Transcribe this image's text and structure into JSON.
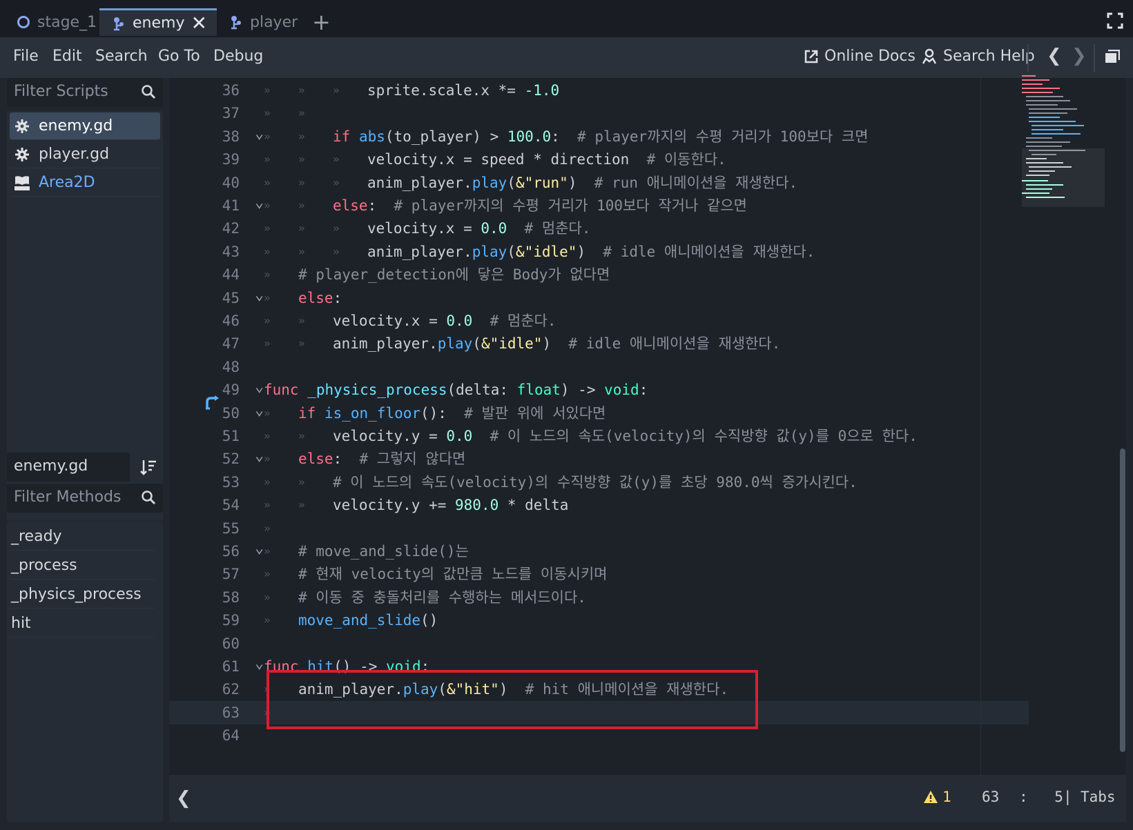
{
  "tabs": [
    {
      "label": "stage_1",
      "icon": "circle-node-icon",
      "active": false
    },
    {
      "label": "enemy",
      "icon": "scene-node-icon",
      "active": true
    },
    {
      "label": "player",
      "icon": "scene-node-icon",
      "active": false
    }
  ],
  "menu": {
    "file": "File",
    "edit": "Edit",
    "search": "Search",
    "goto": "Go To",
    "debug": "Debug"
  },
  "toolbar": {
    "online_docs": "Online Docs",
    "search_help": "Search Help"
  },
  "scripts_panel": {
    "filter_placeholder": "Filter Scripts",
    "items": [
      {
        "label": "enemy.gd",
        "icon": "gear-icon",
        "selected": true
      },
      {
        "label": "player.gd",
        "icon": "gear-icon",
        "selected": false
      },
      {
        "label": "Area2D",
        "icon": "doc-icon",
        "selected": false
      }
    ]
  },
  "methods_panel": {
    "current_script": "enemy.gd",
    "filter_placeholder": "Filter Methods",
    "items": [
      "_ready",
      "_process",
      "_physics_process",
      "hit"
    ]
  },
  "code_lines": [
    {
      "n": "36",
      "fold": false,
      "tabs": 3,
      "tokens": [
        [
          "p",
          "sprite.scale.x *= "
        ],
        [
          "n",
          "-1.0"
        ]
      ]
    },
    {
      "n": "37",
      "fold": false,
      "tabs": 2,
      "tokens": []
    },
    {
      "n": "38",
      "fold": true,
      "tabs": 2,
      "tokens": [
        [
          "k",
          "if "
        ],
        [
          "f",
          "abs"
        ],
        [
          "p",
          "(to_player) > "
        ],
        [
          "n",
          "100.0"
        ],
        [
          "p",
          ":  "
        ],
        [
          "c",
          "# player까지의 수평 거리가 100보다 크면"
        ]
      ]
    },
    {
      "n": "39",
      "fold": false,
      "tabs": 3,
      "tokens": [
        [
          "p",
          "velocity.x = speed * direction  "
        ],
        [
          "c",
          "# 이동한다."
        ]
      ]
    },
    {
      "n": "40",
      "fold": false,
      "tabs": 3,
      "tokens": [
        [
          "p",
          "anim_player."
        ],
        [
          "f",
          "play"
        ],
        [
          "p",
          "("
        ],
        [
          "s",
          "&\"run\""
        ],
        [
          "p",
          ")  "
        ],
        [
          "c",
          "# run 애니메이션을 재생한다."
        ]
      ]
    },
    {
      "n": "41",
      "fold": true,
      "tabs": 2,
      "tokens": [
        [
          "k",
          "else"
        ],
        [
          "p",
          ":  "
        ],
        [
          "c",
          "# player까지의 수평 거리가 100보다 작거나 같으면"
        ]
      ]
    },
    {
      "n": "42",
      "fold": false,
      "tabs": 3,
      "tokens": [
        [
          "p",
          "velocity.x = "
        ],
        [
          "n",
          "0.0"
        ],
        [
          "p",
          "  "
        ],
        [
          "c",
          "# 멈춘다."
        ]
      ]
    },
    {
      "n": "43",
      "fold": false,
      "tabs": 3,
      "tokens": [
        [
          "p",
          "anim_player."
        ],
        [
          "f",
          "play"
        ],
        [
          "p",
          "("
        ],
        [
          "s",
          "&\"idle\""
        ],
        [
          "p",
          ")  "
        ],
        [
          "c",
          "# idle 애니메이션을 재생한다."
        ]
      ]
    },
    {
      "n": "44",
      "fold": false,
      "tabs": 1,
      "tokens": [
        [
          "c",
          "# player_detection에 닿은 Body가 없다면"
        ]
      ]
    },
    {
      "n": "45",
      "fold": true,
      "tabs": 1,
      "tokens": [
        [
          "k",
          "else"
        ],
        [
          "p",
          ":"
        ]
      ]
    },
    {
      "n": "46",
      "fold": false,
      "tabs": 2,
      "tokens": [
        [
          "p",
          "velocity.x = "
        ],
        [
          "n",
          "0.0"
        ],
        [
          "p",
          "  "
        ],
        [
          "c",
          "# 멈춘다."
        ]
      ]
    },
    {
      "n": "47",
      "fold": false,
      "tabs": 2,
      "tokens": [
        [
          "p",
          "anim_player."
        ],
        [
          "f",
          "play"
        ],
        [
          "p",
          "("
        ],
        [
          "s",
          "&\"idle\""
        ],
        [
          "p",
          ")  "
        ],
        [
          "c",
          "# idle 애니메이션을 재생한다."
        ]
      ]
    },
    {
      "n": "48",
      "fold": false,
      "tabs": 0,
      "tokens": []
    },
    {
      "n": "49",
      "fold": true,
      "tabs": 0,
      "tokens": [
        [
          "k",
          "func "
        ],
        [
          "m",
          "_physics_process"
        ],
        [
          "p",
          "(delta: "
        ],
        [
          "t",
          "float"
        ],
        [
          "p",
          ") -> "
        ],
        [
          "t",
          "void"
        ],
        [
          "p",
          ":"
        ]
      ]
    },
    {
      "n": "50",
      "fold": true,
      "tabs": 1,
      "tokens": [
        [
          "k",
          "if "
        ],
        [
          "f",
          "is_on_floor"
        ],
        [
          "p",
          "():  "
        ],
        [
          "c",
          "# 발판 위에 서있다면"
        ]
      ]
    },
    {
      "n": "51",
      "fold": false,
      "tabs": 2,
      "tokens": [
        [
          "p",
          "velocity.y = "
        ],
        [
          "n",
          "0.0"
        ],
        [
          "p",
          "  "
        ],
        [
          "c",
          "# 이 노드의 속도(velocity)의 수직방향 값(y)를 0으로 한다."
        ]
      ]
    },
    {
      "n": "52",
      "fold": true,
      "tabs": 1,
      "tokens": [
        [
          "k",
          "else"
        ],
        [
          "p",
          ":  "
        ],
        [
          "c",
          "# 그렇지 않다면"
        ]
      ]
    },
    {
      "n": "53",
      "fold": false,
      "tabs": 2,
      "tokens": [
        [
          "c",
          "# 이 노드의 속도(velocity)의 수직방향 값(y)를 초당 980.0씩 증가시킨다."
        ]
      ]
    },
    {
      "n": "54",
      "fold": false,
      "tabs": 2,
      "tokens": [
        [
          "p",
          "velocity.y += "
        ],
        [
          "n",
          "980.0"
        ],
        [
          "p",
          " * delta"
        ]
      ]
    },
    {
      "n": "55",
      "fold": false,
      "tabs": 1,
      "tokens": []
    },
    {
      "n": "56",
      "fold": true,
      "tabs": 1,
      "tokens": [
        [
          "c",
          "# move_and_slide()는"
        ]
      ]
    },
    {
      "n": "57",
      "fold": false,
      "tabs": 1,
      "tokens": [
        [
          "c",
          "# 현재 velocity의 값만큼 노드를 이동시키며"
        ]
      ]
    },
    {
      "n": "58",
      "fold": false,
      "tabs": 1,
      "tokens": [
        [
          "c",
          "# 이동 중 충돌처리를 수행하는 메서드이다."
        ]
      ]
    },
    {
      "n": "59",
      "fold": false,
      "tabs": 1,
      "tokens": [
        [
          "f",
          "move_and_slide"
        ],
        [
          "p",
          "()"
        ]
      ]
    },
    {
      "n": "60",
      "fold": false,
      "tabs": 0,
      "tokens": []
    },
    {
      "n": "61",
      "fold": true,
      "tabs": 0,
      "tokens": [
        [
          "k",
          "func "
        ],
        [
          "f",
          "hit"
        ],
        [
          "p",
          "() -> "
        ],
        [
          "t",
          "void"
        ],
        [
          "p",
          ":"
        ]
      ]
    },
    {
      "n": "62",
      "fold": false,
      "tabs": 1,
      "tokens": [
        [
          "p",
          "anim_player."
        ],
        [
          "f",
          "play"
        ],
        [
          "p",
          "("
        ],
        [
          "s",
          "&\"hit\""
        ],
        [
          "p",
          ")  "
        ],
        [
          "c",
          "# hit 애니메이션을 재생한다."
        ]
      ]
    },
    {
      "n": "63",
      "fold": false,
      "tabs": 1,
      "tokens": [],
      "current": true
    },
    {
      "n": "64",
      "fold": false,
      "tabs": 0,
      "tokens": []
    }
  ],
  "status": {
    "warnings": "1",
    "line": "63",
    "col_sep": ":",
    "col": "5",
    "sep": "|",
    "indent": "Tabs"
  },
  "colors": {
    "accent": "#6e9bd8",
    "highlight_box": "#d8202c",
    "warning": "#ffdd65"
  }
}
